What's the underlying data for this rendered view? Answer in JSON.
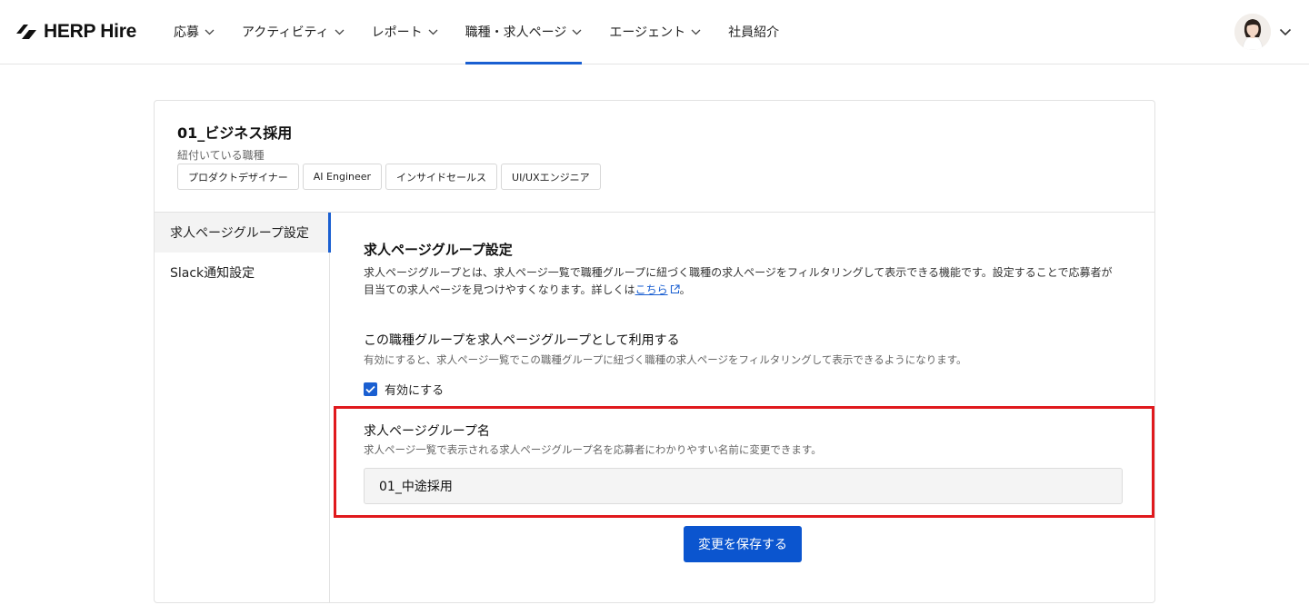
{
  "header": {
    "logo_text": "HERP Hire",
    "nav": [
      {
        "label": "応募",
        "has_dropdown": true
      },
      {
        "label": "アクティビティ",
        "has_dropdown": true
      },
      {
        "label": "レポート",
        "has_dropdown": true
      },
      {
        "label": "職種・求人ページ",
        "has_dropdown": true,
        "active": true
      },
      {
        "label": "エージェント",
        "has_dropdown": true
      },
      {
        "label": "社員紹介",
        "has_dropdown": false
      }
    ]
  },
  "group": {
    "title": "01_ビジネス採用",
    "linked_label": "紐付いている職種",
    "tags": [
      "プロダクトデザイナー",
      "AI Engineer",
      "インサイドセールス",
      "UI/UXエンジニア"
    ]
  },
  "sidebar": {
    "items": [
      {
        "label": "求人ページグループ設定",
        "active": true
      },
      {
        "label": "Slack通知設定",
        "active": false
      }
    ]
  },
  "main": {
    "section_title": "求人ページグループ設定",
    "section_desc_1": "求人ページグループとは、求人ページ一覧で職種グループに紐づく職種の求人ページをフィルタリングして表示できる機能です。設定することで応募者が",
    "section_desc_2": "目当ての求人ページを見つけやすくなります。詳しくは",
    "section_desc_link": "こちら",
    "section_desc_end": "。",
    "option_title": "この職種グループを求人ページグループとして利用する",
    "option_desc": "有効にすると、求人ページ一覧でこの職種グループに紐づく職種の求人ページをフィルタリングして表示できるようになります。",
    "checkbox_label": "有効にする",
    "checkbox_checked": true,
    "name_title": "求人ページグループ名",
    "name_desc": "求人ページ一覧で表示される求人ページグループ名を応募者にわかりやすい名前に変更できます。",
    "name_value": "01_中途採用",
    "save_label": "変更を保存する"
  },
  "colors": {
    "accent": "#1a5fd1",
    "button": "#0b55cf",
    "highlight": "#e0191d"
  }
}
